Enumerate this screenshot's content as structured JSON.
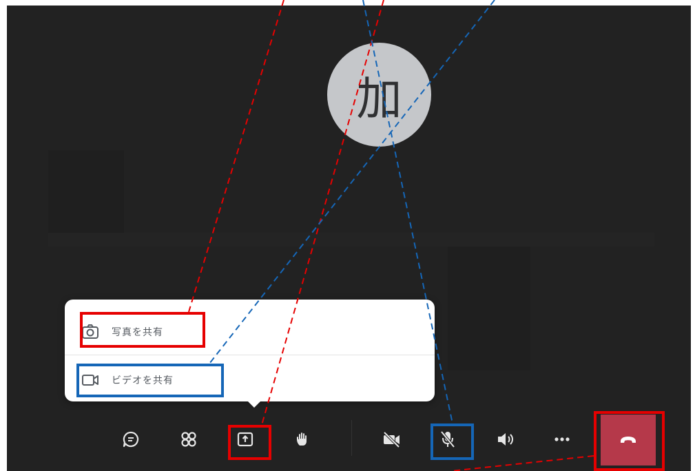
{
  "participant": {
    "avatar_initial": "加"
  },
  "share_menu": {
    "items": [
      {
        "icon": "camera-icon",
        "label": "写真を共有"
      },
      {
        "icon": "video-camera-icon",
        "label": "ビデオを共有"
      }
    ]
  },
  "toolbar": {
    "buttons": [
      {
        "icon": "chat-icon"
      },
      {
        "icon": "participants-icon"
      },
      {
        "icon": "share-screen-icon"
      },
      {
        "icon": "raise-hand-icon"
      },
      {
        "icon": "camera-off-icon"
      },
      {
        "icon": "mic-muted-icon"
      },
      {
        "icon": "speaker-icon"
      },
      {
        "icon": "more-options-icon"
      },
      {
        "icon": "end-call-icon"
      }
    ]
  },
  "colors": {
    "background": "#222222",
    "avatar": "#c5c7ca",
    "end_call": "#b5394a",
    "highlight_red": "#e60000",
    "highlight_blue": "#1566b7"
  }
}
